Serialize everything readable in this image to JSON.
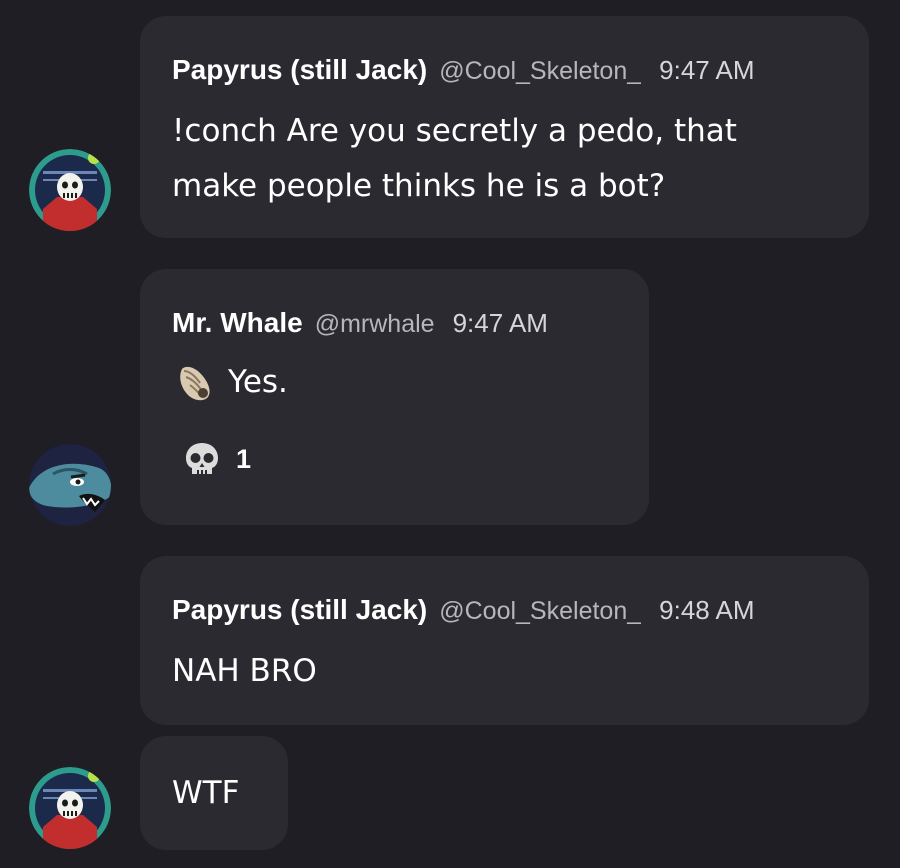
{
  "messages": [
    {
      "author": "Papyrus (still Jack)",
      "handle": "@Cool_Skeleton_",
      "time": "9:47 AM",
      "text": "!conch Are you secretly a pedo, that\nmake people thinks he is a bot?",
      "avatar": "papyrus-avatar"
    },
    {
      "author": "Mr. Whale",
      "handle": "@mrwhale",
      "time": "9:47 AM",
      "text": "Yes.",
      "emoji_icon": "spiral-shell-icon",
      "reaction": {
        "icon": "skull-icon",
        "count": "1"
      },
      "avatar": "whale-avatar"
    },
    {
      "author": "Papyrus (still Jack)",
      "handle": "@Cool_Skeleton_",
      "time": "9:48 AM",
      "text": "NAH BRO",
      "avatar": "papyrus-avatar"
    },
    {
      "text": "WTF",
      "avatar": "papyrus-avatar"
    }
  ],
  "colors": {
    "background": "#1f1e25",
    "bubble": "#2b2a31",
    "text": "#ffffff",
    "handle": "#b7b6bc",
    "papyrus_ring": "#2e9c8c",
    "whale_bg": "#1d2340"
  }
}
